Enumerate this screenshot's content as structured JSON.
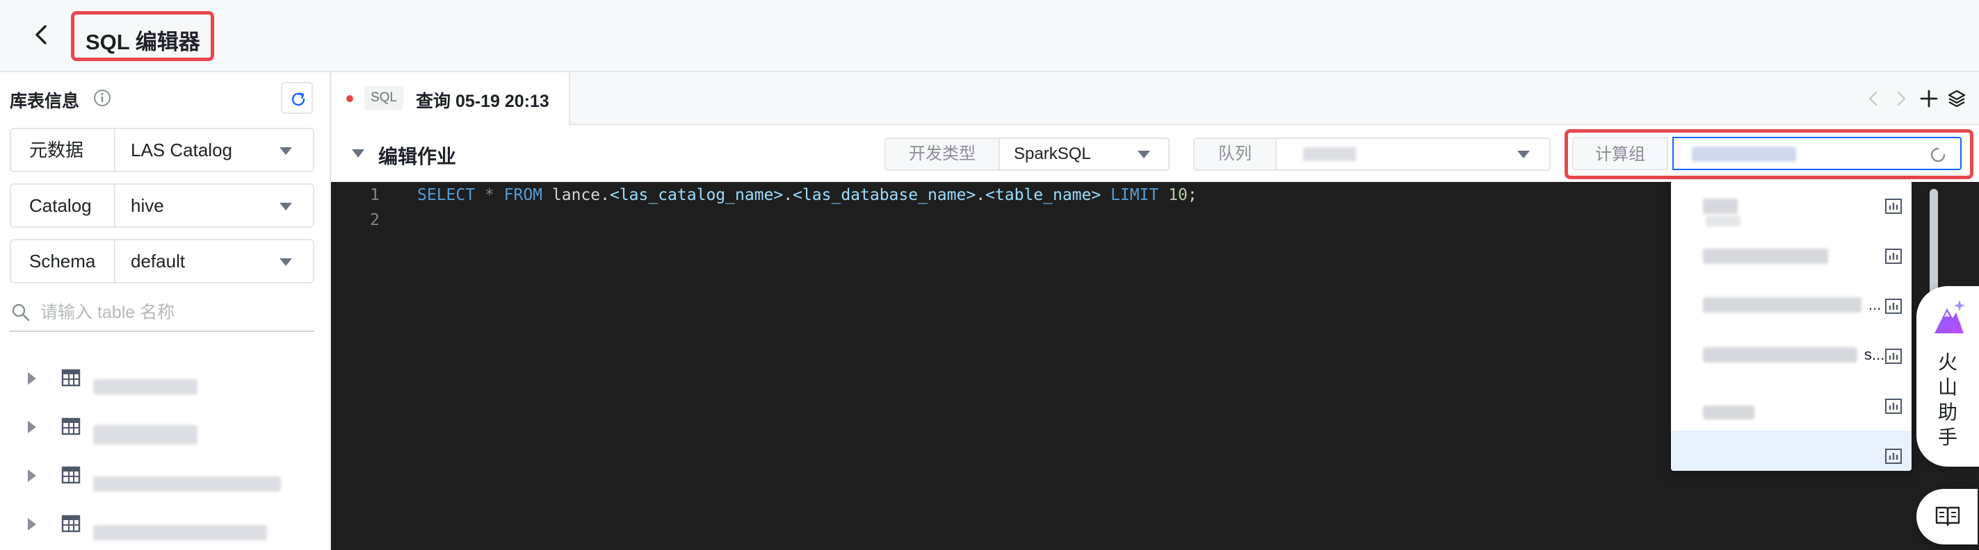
{
  "header": {
    "title": "SQL 编辑器"
  },
  "sidebar": {
    "title": "库表信息",
    "fields": [
      {
        "label": "元数据",
        "value": "LAS Catalog"
      },
      {
        "label": "Catalog",
        "value": "hive"
      },
      {
        "label": "Schema",
        "value": "default"
      }
    ],
    "search_placeholder": "请输入 table 名称"
  },
  "tabs": [
    {
      "badge": "SQL",
      "label": "查询 05-19 20:13"
    }
  ],
  "toolbar": {
    "section_title": "编辑作业",
    "dev_type_label": "开发类型",
    "dev_type_value": "SparkSQL",
    "queue_label": "队列",
    "compute_group_label": "计算组"
  },
  "editor": {
    "line_numbers": [
      "1",
      "2"
    ],
    "code": {
      "select": "SELECT",
      "star": " * ",
      "from": "FROM",
      "db": " lance.",
      "catalog": "<las_catalog_name>",
      "dot1": ".",
      "database": "<las_database_name>",
      "dot2": ".",
      "table": "<table_name>",
      "space": " ",
      "limit": "LIMIT",
      "num": " 10",
      "semi": ";"
    }
  },
  "dropdown": {
    "ellipses": [
      "...",
      "s...",
      "..."
    ]
  },
  "assistant": {
    "label": "火山助手"
  },
  "colors": {
    "highlight": "#e5484d",
    "accent": "#1664ff"
  }
}
